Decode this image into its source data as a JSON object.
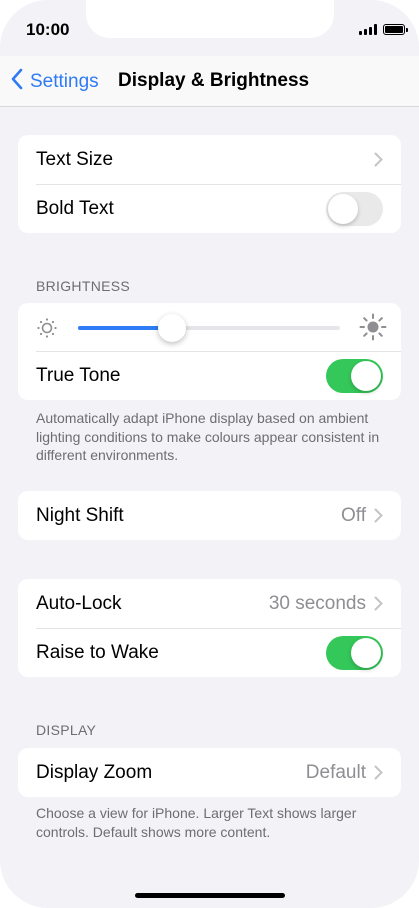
{
  "status_bar": {
    "time": "10:00"
  },
  "nav": {
    "back_label": "Settings",
    "title": "Display & Brightness"
  },
  "text_group": {
    "text_size_label": "Text Size",
    "bold_text_label": "Bold Text",
    "bold_text_on": false
  },
  "brightness": {
    "header": "BRIGHTNESS",
    "level_fraction": 0.36,
    "true_tone_label": "True Tone",
    "true_tone_on": true,
    "footer": "Automatically adapt iPhone display based on ambient lighting conditions to make colours appear consistent in different environments."
  },
  "night_shift": {
    "label": "Night Shift",
    "value": "Off"
  },
  "lock_group": {
    "auto_lock_label": "Auto-Lock",
    "auto_lock_value": "30 seconds",
    "raise_to_wake_label": "Raise to Wake",
    "raise_to_wake_on": true
  },
  "display": {
    "header": "DISPLAY",
    "zoom_label": "Display Zoom",
    "zoom_value": "Default",
    "footer": "Choose a view for iPhone. Larger Text shows larger controls. Default shows more content."
  },
  "colors": {
    "accent": "#2f7bf5",
    "toggle_on": "#34c759",
    "toggle_off": "#e9e9ea",
    "background": "#f2f2f7"
  }
}
